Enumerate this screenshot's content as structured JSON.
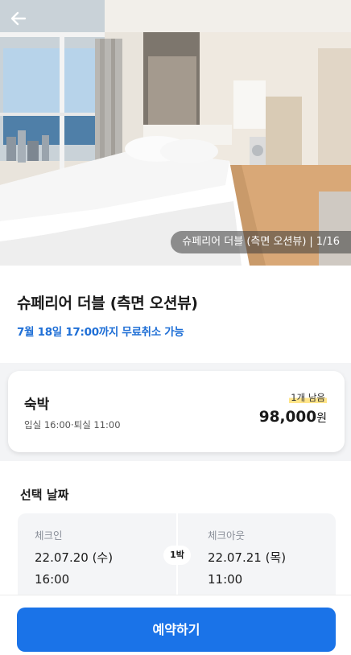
{
  "hero": {
    "caption_name": "슈페리어 더블 (측면 오션뷰)",
    "caption_separator": "|",
    "caption_counter": "1/16"
  },
  "room": {
    "title": "슈페리어 더블 (측면 오션뷰)",
    "cancel_note": "7월 18일 17:00까지 무료취소 가능"
  },
  "stay_card": {
    "label": "숙박",
    "times": "입실 16:00·퇴실 11:00",
    "remaining": "1개 남음",
    "price": "98,000",
    "price_unit": "원"
  },
  "dates": {
    "heading": "선택 날짜",
    "checkin_label": "체크인",
    "checkin_date": "22.07.20 (수)",
    "checkin_time": "16:00",
    "checkout_label": "체크아웃",
    "checkout_date": "22.07.21 (목)",
    "checkout_time": "11:00",
    "nights": "1박"
  },
  "footer": {
    "reserve_label": "예약하기"
  },
  "colors": {
    "accent": "#1a73e8",
    "cancel_text": "#1f6fd6",
    "badge_highlight": "#ffe58a"
  },
  "icons": {
    "back": "arrow-left-icon"
  }
}
